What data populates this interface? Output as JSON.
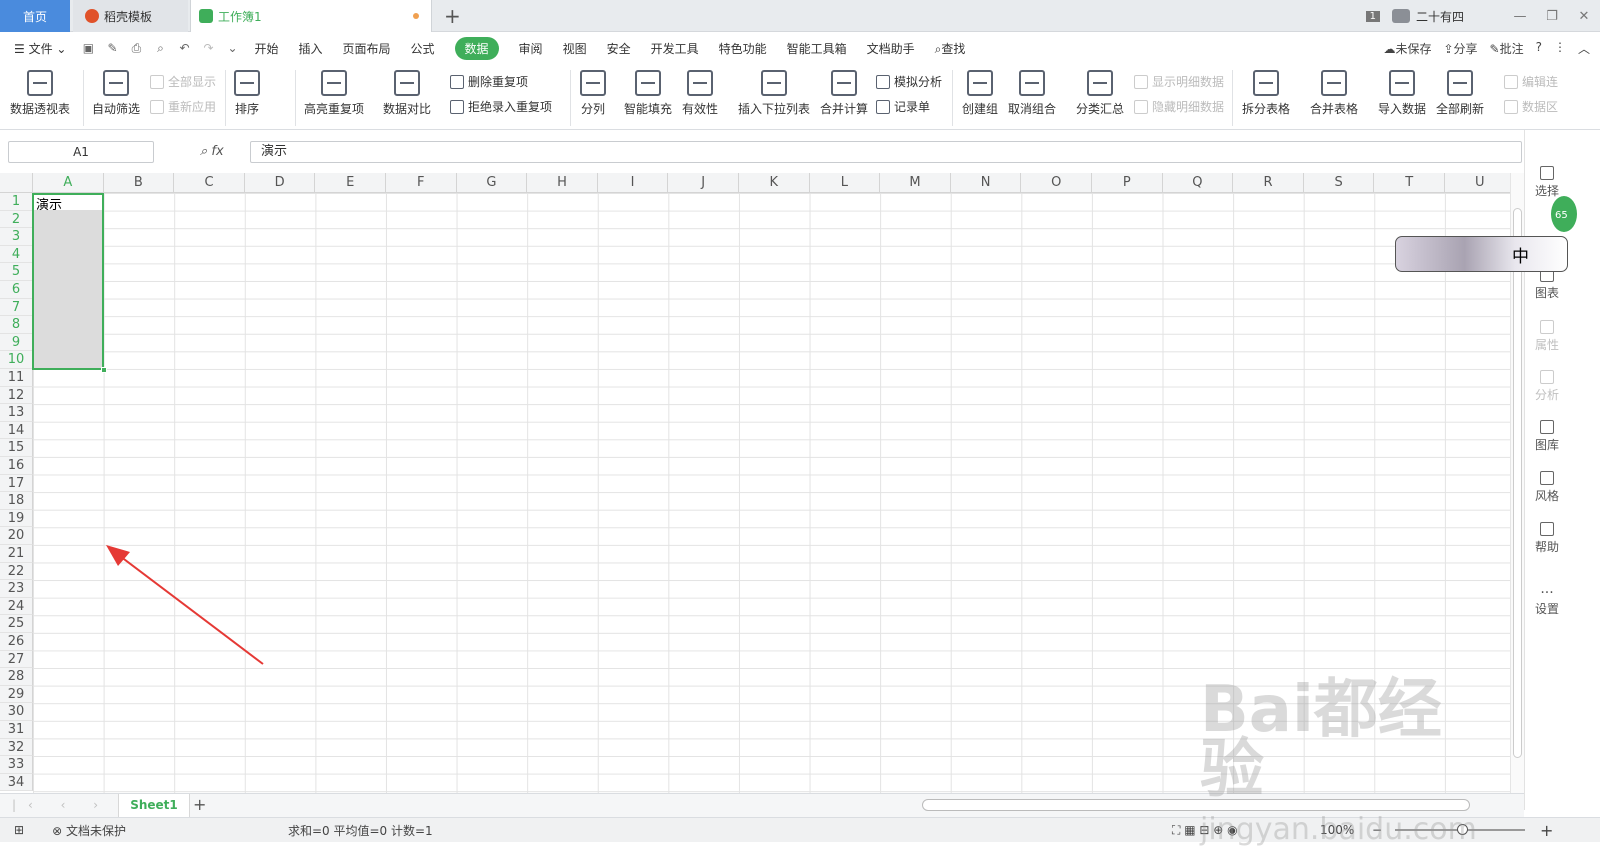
{
  "titlebar": {
    "tabs": [
      {
        "label": "首页"
      },
      {
        "label": "稻壳模板"
      },
      {
        "label": "工作簿1"
      }
    ],
    "new_tab": "+",
    "window_badge": "1",
    "user_name": "二十有四",
    "win_min": "—",
    "win_max": "❐",
    "win_close": "✕"
  },
  "menu": {
    "file": "文件",
    "items": [
      "开始",
      "插入",
      "页面布局",
      "公式",
      "数据",
      "审阅",
      "视图",
      "安全",
      "开发工具",
      "特色功能",
      "智能工具箱",
      "文档助手"
    ],
    "search": "查找",
    "unsaved": "未保存",
    "share": "分享",
    "annotate": "批注",
    "help": "?"
  },
  "ribbon": {
    "pivot": "数据透视表",
    "autofilter": "自动筛选",
    "show_all": "全部显示",
    "reapply": "重新应用",
    "sort": "排序",
    "highlight_dup": "高亮重复项",
    "compare": "数据对比",
    "delete_dup": "删除重复项",
    "reject_dup": "拒绝录入重复项",
    "split_col": "分列",
    "smart_fill": "智能填充",
    "validity": "有效性",
    "dropdown": "插入下拉列表",
    "consolidate": "合并计算",
    "whatif": "模拟分析",
    "record": "记录单",
    "group": "创建组",
    "ungroup": "取消组合",
    "subtotal": "分类汇总",
    "show_detail": "显示明细数据",
    "hide_detail": "隐藏明细数据",
    "split_table": "拆分表格",
    "merge_table": "合并表格",
    "import": "导入数据",
    "refresh_all": "全部刷新",
    "edit_link": "编辑连",
    "data_src": "数据区"
  },
  "formula_bar": {
    "name_box": "A1",
    "fx": "fx",
    "content": "演示"
  },
  "grid": {
    "columns": [
      "A",
      "B",
      "C",
      "D",
      "E",
      "F",
      "G",
      "H",
      "I",
      "J",
      "K",
      "L",
      "M",
      "N",
      "O",
      "P",
      "Q",
      "R",
      "S",
      "T",
      "U"
    ],
    "rows": [
      "1",
      "2",
      "3",
      "4",
      "5",
      "6",
      "7",
      "8",
      "9",
      "10",
      "11",
      "12",
      "13",
      "14",
      "15",
      "16",
      "17",
      "18",
      "19",
      "20",
      "21",
      "22",
      "23",
      "24",
      "25",
      "26",
      "27",
      "28",
      "29",
      "30",
      "31",
      "32",
      "33",
      "34"
    ],
    "a1": "演示"
  },
  "sidebar": [
    "选择",
    "图表",
    "属性",
    "分析",
    "图库",
    "风格",
    "帮助",
    "设置"
  ],
  "sheet": {
    "name": "Sheet1",
    "add": "+"
  },
  "status": {
    "protect": "文档未保护",
    "stats": "求和=0  平均值=0  计数=1",
    "zoom": "100%"
  },
  "float_widget": {
    "label": "中"
  },
  "green_badge": "65",
  "watermark": {
    "main": "Bai都经验",
    "sub": "jingyan.baidu.com"
  },
  "colors": {
    "accent": "#3fae5a",
    "home_tab": "#4a8bdd",
    "arrow": "#e53935"
  }
}
